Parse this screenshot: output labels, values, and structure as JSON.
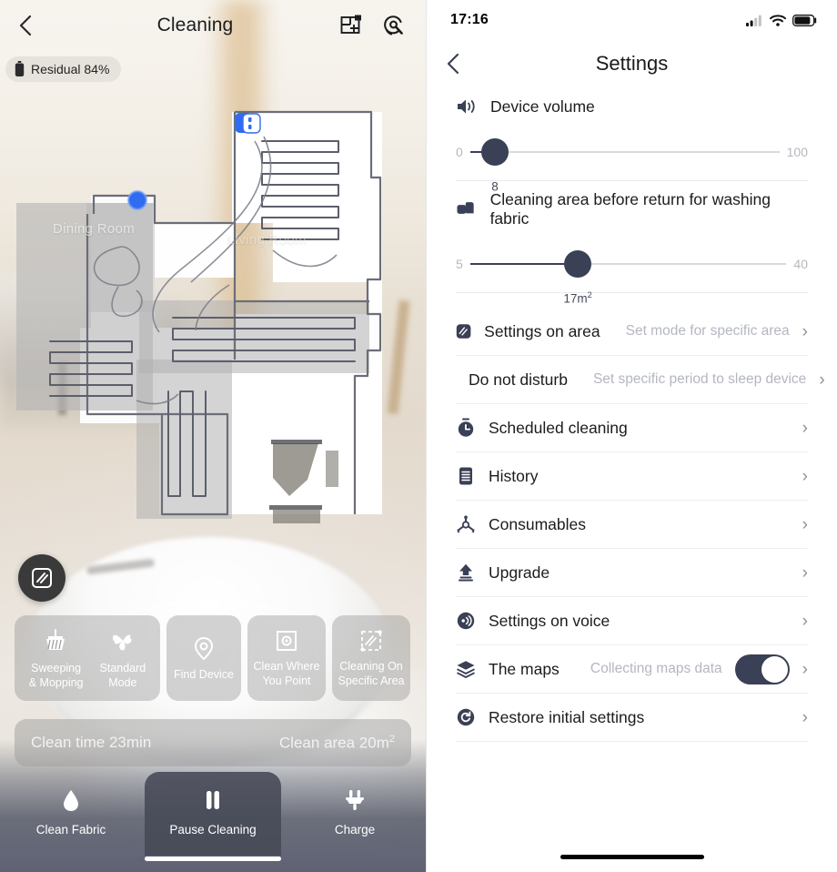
{
  "left": {
    "header": {
      "back_icon": "chevron-left-icon",
      "title": "Cleaning",
      "map_edit_icon": "floorplan-edit-icon",
      "maintenance_icon": "maintenance-wrench-icon"
    },
    "battery_badge": {
      "icon": "battery-icon",
      "text": "Residual 84%"
    },
    "map": {
      "room_labels": [
        "Dining Room",
        "Living Room"
      ],
      "dock_marker": "charging-dock-marker",
      "robot_marker": "robot-position-marker"
    },
    "zone_fab": {
      "icon": "zone-stripes-icon"
    },
    "chips": [
      {
        "icon": "broom-icon",
        "label": "Sweeping\n& Mopping"
      },
      {
        "icon": "fan-icon",
        "label": "Standard\nMode"
      },
      {
        "icon": "location-pin-icon",
        "label": "Find Device"
      },
      {
        "icon": "point-target-icon",
        "label": "Clean Where\nYou Point"
      },
      {
        "icon": "dashed-area-icon",
        "label": "Cleaning On\nSpecific Area"
      }
    ],
    "stats": {
      "time_label": "Clean time 23min",
      "area_label": "Clean area 20m",
      "area_sup": "2"
    },
    "tabs": [
      {
        "icon": "water-drop-icon",
        "label": "Clean Fabric",
        "active": "false"
      },
      {
        "icon": "pause-icon",
        "label": "Pause Cleaning",
        "active": "true"
      },
      {
        "icon": "plug-icon",
        "label": "Charge",
        "active": "false"
      }
    ]
  },
  "right": {
    "statusbar": {
      "time": "17:16",
      "signal_icon": "cellular-signal-icon",
      "wifi_icon": "wifi-icon",
      "battery_icon": "battery-full-icon"
    },
    "header": {
      "back_icon": "chevron-left-icon",
      "title": "Settings"
    },
    "sliders": [
      {
        "icon": "speaker-volume-icon",
        "label": "Device volume",
        "min": "0",
        "max": "100",
        "value": "8",
        "value_sup": "",
        "percent": 8
      },
      {
        "icon": "area-squares-icon",
        "label": "Cleaning area before return for washing fabric",
        "min": "5",
        "max": "40",
        "value": "17m",
        "value_sup": "2",
        "percent": 34
      }
    ],
    "items": [
      {
        "icon": "zone-stripes-icon",
        "label": "Settings on area",
        "value": "Set mode for specific area",
        "toggle": ""
      },
      {
        "icon": "do-not-disturb-icon",
        "label": "Do not disturb",
        "value": "Set specific period to sleep device",
        "toggle": ""
      },
      {
        "icon": "clock-timer-icon",
        "label": "Scheduled cleaning",
        "value": "",
        "toggle": ""
      },
      {
        "icon": "history-list-icon",
        "label": "History",
        "value": "",
        "toggle": ""
      },
      {
        "icon": "brush-consumable-icon",
        "label": "Consumables",
        "value": "",
        "toggle": ""
      },
      {
        "icon": "upgrade-arrow-icon",
        "label": "Upgrade",
        "value": "",
        "toggle": ""
      },
      {
        "icon": "voice-waves-icon",
        "label": "Settings on voice",
        "value": "",
        "toggle": ""
      },
      {
        "icon": "layers-maps-icon",
        "label": "The maps",
        "value": "Collecting maps data",
        "toggle": "on"
      },
      {
        "icon": "restore-refresh-icon",
        "label": "Restore initial settings",
        "value": "",
        "toggle": ""
      }
    ]
  },
  "colors": {
    "accent_navy": "#3a4055",
    "muted_text": "#b4b7c0",
    "chip_bg": "rgba(150,150,150,.42)",
    "robot_blue": "#2f6cf0"
  }
}
